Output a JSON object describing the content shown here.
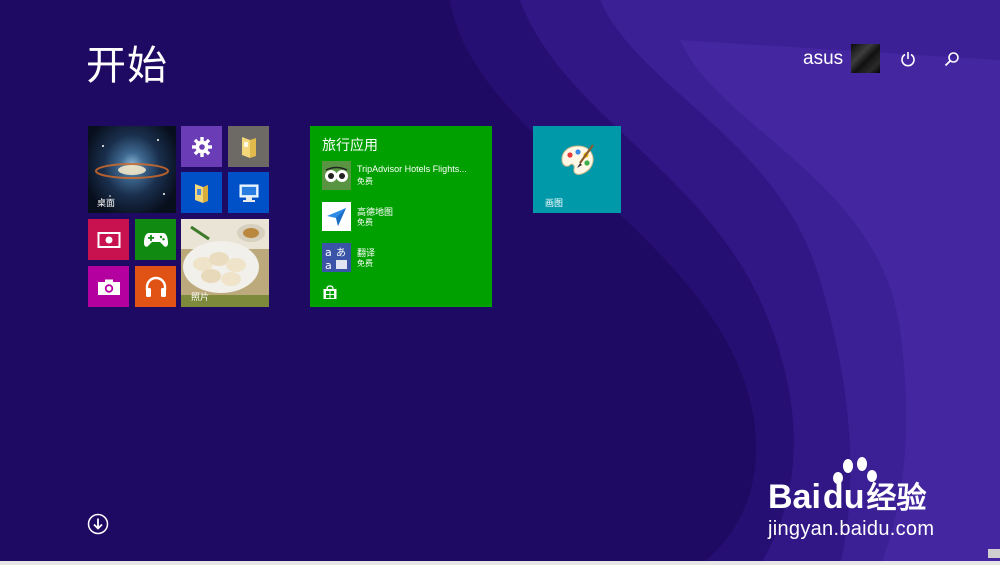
{
  "start": {
    "title": "开始",
    "user_name": "asus"
  },
  "tiles": {
    "desktop_label": "桌面",
    "photos_label": "照片",
    "paint_label": "画图"
  },
  "group": {
    "title": "旅行应用",
    "apps": [
      {
        "name": "TripAdvisor Hotels Flights...",
        "sub": "免费"
      },
      {
        "name": "高德地图",
        "sub": "免费"
      },
      {
        "name": "翻译",
        "sub": "免费"
      }
    ]
  },
  "icons": {
    "power": "power-icon",
    "search": "search-icon",
    "all_apps": "arrow-down-circle-icon",
    "settings": "gear-icon",
    "store": "store-icon"
  },
  "colors": {
    "background": "#1f0a63",
    "settings_tile": "#6a3cb5",
    "file_tile": "#0050c8",
    "video_tile": "#c8114f",
    "games_tile": "#108a10",
    "camera_tile": "#b4009e",
    "music_tile": "#e05314",
    "group_tile": "#00a000",
    "paint_tile": "#0099aa"
  },
  "watermark": {
    "brand_a": "Bai",
    "brand_b": "du",
    "brand_c": "经验",
    "url": "jingyan.baidu.com"
  }
}
